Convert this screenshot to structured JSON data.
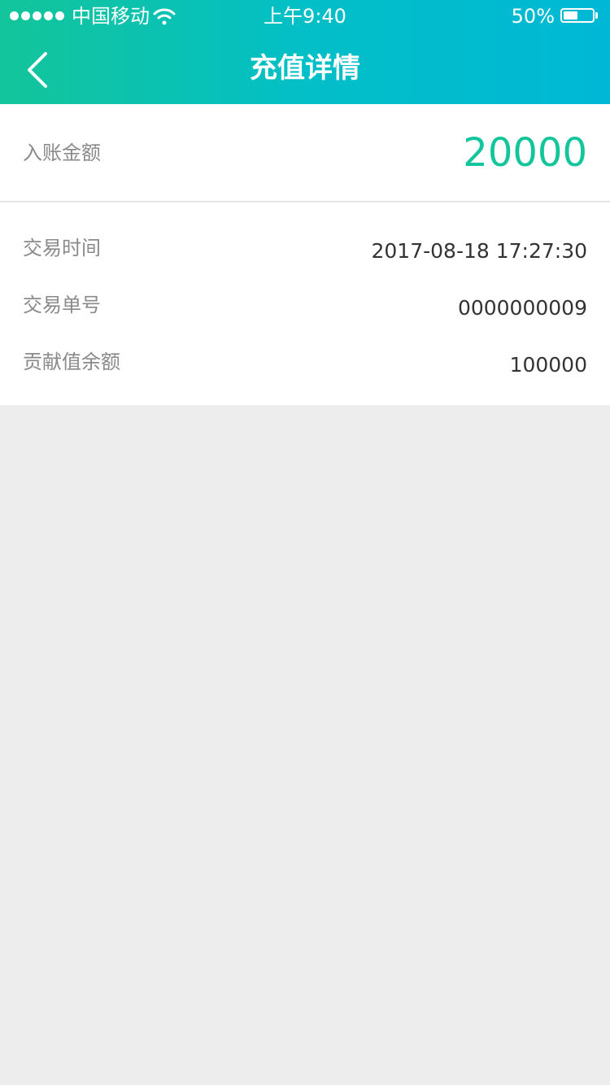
{
  "status_bar": {
    "carrier": "中国移动",
    "time": "上午9:40",
    "battery_percent": "50%",
    "battery_level": 0.5
  },
  "nav": {
    "title": "充值详情"
  },
  "amount": {
    "label": "入账金额",
    "value": "20000"
  },
  "details": [
    {
      "label": "交易时间",
      "value": "2017-08-18 17:27:30"
    },
    {
      "label": "交易单号",
      "value": "0000000009"
    },
    {
      "label": "贡献值余额",
      "value": "100000"
    }
  ],
  "colors": {
    "accent": "#13c59a",
    "header_gradient_end": "#00b8d6",
    "background": "#ededed"
  }
}
